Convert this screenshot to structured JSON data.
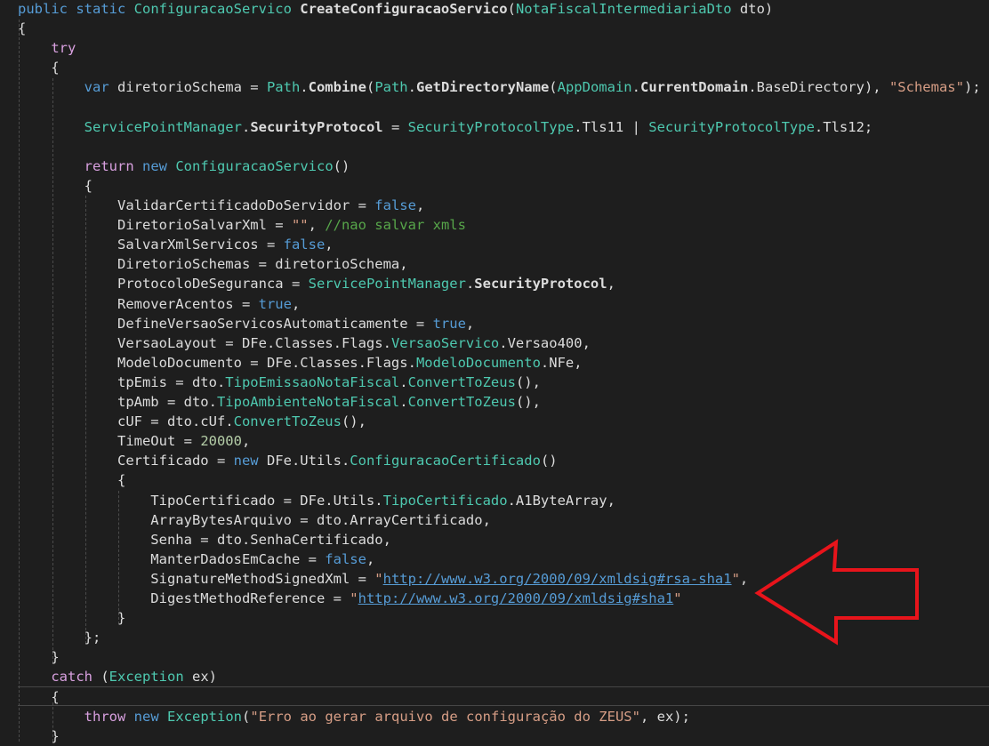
{
  "code": {
    "lines": [
      [
        {
          "t": "public static ",
          "c": "kw"
        },
        {
          "t": "ConfiguracaoServico ",
          "c": "ty"
        },
        {
          "t": "CreateConfiguracaoServico",
          "c": "bold"
        },
        {
          "t": "(",
          "c": "plain"
        },
        {
          "t": "NotaFiscalIntermediariaDto",
          "c": "ty"
        },
        {
          "t": " dto)",
          "c": "plain"
        }
      ],
      [
        {
          "t": "{",
          "c": "plain"
        }
      ],
      [
        {
          "t": "    "
        },
        {
          "t": "try",
          "c": "ctl"
        }
      ],
      [
        {
          "t": "    {",
          "c": "plain"
        }
      ],
      [
        {
          "t": "        "
        },
        {
          "t": "var",
          "c": "kw"
        },
        {
          "t": " diretorioSchema = ",
          "c": "plain"
        },
        {
          "t": "Path",
          "c": "ty"
        },
        {
          "t": ".",
          "c": "plain"
        },
        {
          "t": "Combine",
          "c": "bold"
        },
        {
          "t": "(",
          "c": "plain"
        },
        {
          "t": "Path",
          "c": "ty"
        },
        {
          "t": ".",
          "c": "plain"
        },
        {
          "t": "GetDirectoryName",
          "c": "bold"
        },
        {
          "t": "(",
          "c": "plain"
        },
        {
          "t": "AppDomain",
          "c": "ty"
        },
        {
          "t": ".",
          "c": "plain"
        },
        {
          "t": "CurrentDomain",
          "c": "bold"
        },
        {
          "t": ".BaseDirectory), ",
          "c": "plain"
        },
        {
          "t": "\"Schemas\"",
          "c": "str"
        },
        {
          "t": ");",
          "c": "plain"
        }
      ],
      [
        {
          "t": ""
        }
      ],
      [
        {
          "t": "        "
        },
        {
          "t": "ServicePointManager",
          "c": "ty"
        },
        {
          "t": ".",
          "c": "plain"
        },
        {
          "t": "SecurityProtocol",
          "c": "bold"
        },
        {
          "t": " = ",
          "c": "plain"
        },
        {
          "t": "SecurityProtocolType",
          "c": "ty"
        },
        {
          "t": ".Tls11 | ",
          "c": "plain"
        },
        {
          "t": "SecurityProtocolType",
          "c": "ty"
        },
        {
          "t": ".Tls12;",
          "c": "plain"
        }
      ],
      [
        {
          "t": ""
        }
      ],
      [
        {
          "t": "        "
        },
        {
          "t": "return",
          "c": "ctl"
        },
        {
          "t": " "
        },
        {
          "t": "new",
          "c": "kw"
        },
        {
          "t": " "
        },
        {
          "t": "ConfiguracaoServico",
          "c": "ty"
        },
        {
          "t": "()",
          "c": "plain"
        }
      ],
      [
        {
          "t": "        {",
          "c": "plain"
        }
      ],
      [
        {
          "t": "            ValidarCertificadoDoServidor = ",
          "c": "plain"
        },
        {
          "t": "false",
          "c": "kw"
        },
        {
          "t": ",",
          "c": "plain"
        }
      ],
      [
        {
          "t": "            DiretorioSalvarXml = ",
          "c": "plain"
        },
        {
          "t": "\"\"",
          "c": "str"
        },
        {
          "t": ", ",
          "c": "plain"
        },
        {
          "t": "//nao salvar xmls",
          "c": "cm"
        }
      ],
      [
        {
          "t": "            SalvarXmlServicos = ",
          "c": "plain"
        },
        {
          "t": "false",
          "c": "kw"
        },
        {
          "t": ",",
          "c": "plain"
        }
      ],
      [
        {
          "t": "            DiretorioSchemas = diretorioSchema,",
          "c": "plain"
        }
      ],
      [
        {
          "t": "            ProtocoloDeSeguranca = ",
          "c": "plain"
        },
        {
          "t": "ServicePointManager",
          "c": "ty"
        },
        {
          "t": ".",
          "c": "plain"
        },
        {
          "t": "SecurityProtocol",
          "c": "bold"
        },
        {
          "t": ",",
          "c": "plain"
        }
      ],
      [
        {
          "t": "            RemoverAcentos = ",
          "c": "plain"
        },
        {
          "t": "true",
          "c": "kw"
        },
        {
          "t": ",",
          "c": "plain"
        }
      ],
      [
        {
          "t": "            DefineVersaoServicosAutomaticamente = ",
          "c": "plain"
        },
        {
          "t": "true",
          "c": "kw"
        },
        {
          "t": ",",
          "c": "plain"
        }
      ],
      [
        {
          "t": "            VersaoLayout = DFe.Classes.Flags.",
          "c": "plain"
        },
        {
          "t": "VersaoServico",
          "c": "ty"
        },
        {
          "t": ".Versao400,",
          "c": "plain"
        }
      ],
      [
        {
          "t": "            ModeloDocumento = DFe.Classes.Flags.",
          "c": "plain"
        },
        {
          "t": "ModeloDocumento",
          "c": "ty"
        },
        {
          "t": ".NFe,",
          "c": "plain"
        }
      ],
      [
        {
          "t": "            tpEmis = dto.",
          "c": "plain"
        },
        {
          "t": "TipoEmissaoNotaFiscal",
          "c": "ty"
        },
        {
          "t": ".",
          "c": "plain"
        },
        {
          "t": "ConvertToZeus",
          "c": "ty"
        },
        {
          "t": "(),",
          "c": "plain"
        }
      ],
      [
        {
          "t": "            tpAmb = dto.",
          "c": "plain"
        },
        {
          "t": "TipoAmbienteNotaFiscal",
          "c": "ty"
        },
        {
          "t": ".",
          "c": "plain"
        },
        {
          "t": "ConvertToZeus",
          "c": "ty"
        },
        {
          "t": "(),",
          "c": "plain"
        }
      ],
      [
        {
          "t": "            cUF = dto.cUf.",
          "c": "plain"
        },
        {
          "t": "ConvertToZeus",
          "c": "ty"
        },
        {
          "t": "(),",
          "c": "plain"
        }
      ],
      [
        {
          "t": "            TimeOut = ",
          "c": "plain"
        },
        {
          "t": "20000",
          "c": "num"
        },
        {
          "t": ",",
          "c": "plain"
        }
      ],
      [
        {
          "t": "            Certificado = ",
          "c": "plain"
        },
        {
          "t": "new",
          "c": "kw"
        },
        {
          "t": " DFe.Utils.",
          "c": "plain"
        },
        {
          "t": "ConfiguracaoCertificado",
          "c": "ty"
        },
        {
          "t": "()",
          "c": "plain"
        }
      ],
      [
        {
          "t": "            {",
          "c": "plain"
        }
      ],
      [
        {
          "t": "                TipoCertificado = DFe.Utils.",
          "c": "plain"
        },
        {
          "t": "TipoCertificado",
          "c": "ty"
        },
        {
          "t": ".A1ByteArray,",
          "c": "plain"
        }
      ],
      [
        {
          "t": "                ArrayBytesArquivo = dto.ArrayCertificado,",
          "c": "plain"
        }
      ],
      [
        {
          "t": "                Senha = dto.SenhaCertificado,",
          "c": "plain"
        }
      ],
      [
        {
          "t": "                ManterDadosEmCache = ",
          "c": "plain"
        },
        {
          "t": "false",
          "c": "kw"
        },
        {
          "t": ",",
          "c": "plain"
        }
      ],
      [
        {
          "t": "                SignatureMethodSignedXml = ",
          "c": "plain"
        },
        {
          "t": "\"",
          "c": "str"
        },
        {
          "t": "http://www.w3.org/2000/09/xmldsig#rsa-sha1",
          "c": "lnk"
        },
        {
          "t": "\"",
          "c": "str"
        },
        {
          "t": ",",
          "c": "plain"
        }
      ],
      [
        {
          "t": "                DigestMethodReference = ",
          "c": "plain"
        },
        {
          "t": "\"",
          "c": "str"
        },
        {
          "t": "http://www.w3.org/2000/09/xmldsig#sha1",
          "c": "lnk"
        },
        {
          "t": "\"",
          "c": "str"
        }
      ],
      [
        {
          "t": "            }",
          "c": "plain"
        }
      ],
      [
        {
          "t": "        };",
          "c": "plain"
        }
      ],
      [
        {
          "t": "    }",
          "c": "plain"
        }
      ],
      [
        {
          "t": "    "
        },
        {
          "t": "catch",
          "c": "ctl"
        },
        {
          "t": " (",
          "c": "plain"
        },
        {
          "t": "Exception",
          "c": "ty"
        },
        {
          "t": " ex)",
          "c": "plain"
        }
      ],
      [
        {
          "t": "    {",
          "c": "plain"
        }
      ],
      [
        {
          "t": "        "
        },
        {
          "t": "throw",
          "c": "ctl"
        },
        {
          "t": " "
        },
        {
          "t": "new",
          "c": "kw"
        },
        {
          "t": " "
        },
        {
          "t": "Exception",
          "c": "ty"
        },
        {
          "t": "(",
          "c": "plain"
        },
        {
          "t": "\"Erro ao gerar arquivo de configuração do ZEUS\"",
          "c": "str"
        },
        {
          "t": ", ex);",
          "c": "plain"
        }
      ],
      [
        {
          "t": "    }",
          "c": "plain"
        }
      ]
    ]
  },
  "colors": {
    "background": "#1e1e1e",
    "annotation_arrow": "#e8141b"
  },
  "annotation": {
    "icon": "left-arrow-icon"
  }
}
